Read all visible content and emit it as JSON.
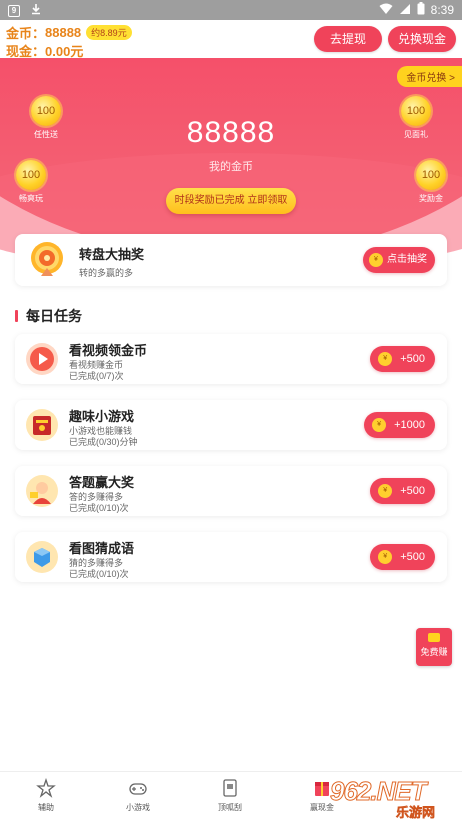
{
  "status_bar": {
    "time": "8:39"
  },
  "header": {
    "coins_label": "金币：",
    "coins_value": "88888",
    "coins_approx": "约8.89元",
    "cash_label": "现金：",
    "cash_value": "0.00元",
    "withdraw_button": "去提现",
    "exchange_button": "兑换现金"
  },
  "hero": {
    "exchange_tab": "金币兑换 >",
    "coin_count": "88888",
    "coin_caption": "我的金币",
    "claim_button": "时段奖励已完成 立即领取",
    "bubbles": [
      {
        "amount": "100",
        "label": "任性送"
      },
      {
        "amount": "100",
        "label": "畅爽玩"
      },
      {
        "amount": "100",
        "label": "见面礼"
      },
      {
        "amount": "100",
        "label": "奖励金"
      }
    ]
  },
  "lottery": {
    "title": "转盘大抽奖",
    "subtitle": "转的多赢的多",
    "button": "点击抽奖",
    "coin_glyph": "¥"
  },
  "daily": {
    "title": "每日任务",
    "tasks": [
      {
        "title": "看视频领金币",
        "desc": "看视频赚金币",
        "progress": "已完成(0/7)次",
        "reward": "+500",
        "icon": "video-play-icon"
      },
      {
        "title": "趣味小游戏",
        "desc": "小游戏也能赚钱",
        "progress": "已完成(0/30)分钟",
        "reward": "+1000",
        "icon": "game-book-icon"
      },
      {
        "title": "答题赢大奖",
        "desc": "答的多赚得多",
        "progress": "已完成(0/10)次",
        "reward": "+500",
        "icon": "quiz-kid-icon"
      },
      {
        "title": "看图猜成语",
        "desc": "猜的多赚得多",
        "progress": "已完成(0/10)次",
        "reward": "+500",
        "icon": "puzzle-cube-icon"
      }
    ]
  },
  "float_badge": {
    "label": "免费赚"
  },
  "nav": {
    "items": [
      {
        "label": "辅助",
        "icon": "star-settings-icon"
      },
      {
        "label": "小游戏",
        "icon": "gamepad-icon"
      },
      {
        "label": "顶呱刮",
        "icon": "scratch-card-icon"
      },
      {
        "label": "赢现金",
        "icon": "cash-gift-icon"
      }
    ]
  },
  "watermark": {
    "text": "962.NET",
    "sub": "乐游网"
  },
  "colors": {
    "accent_red": "#f0435a",
    "coin_orange": "#e8841a",
    "gold": "#ffd21e"
  }
}
